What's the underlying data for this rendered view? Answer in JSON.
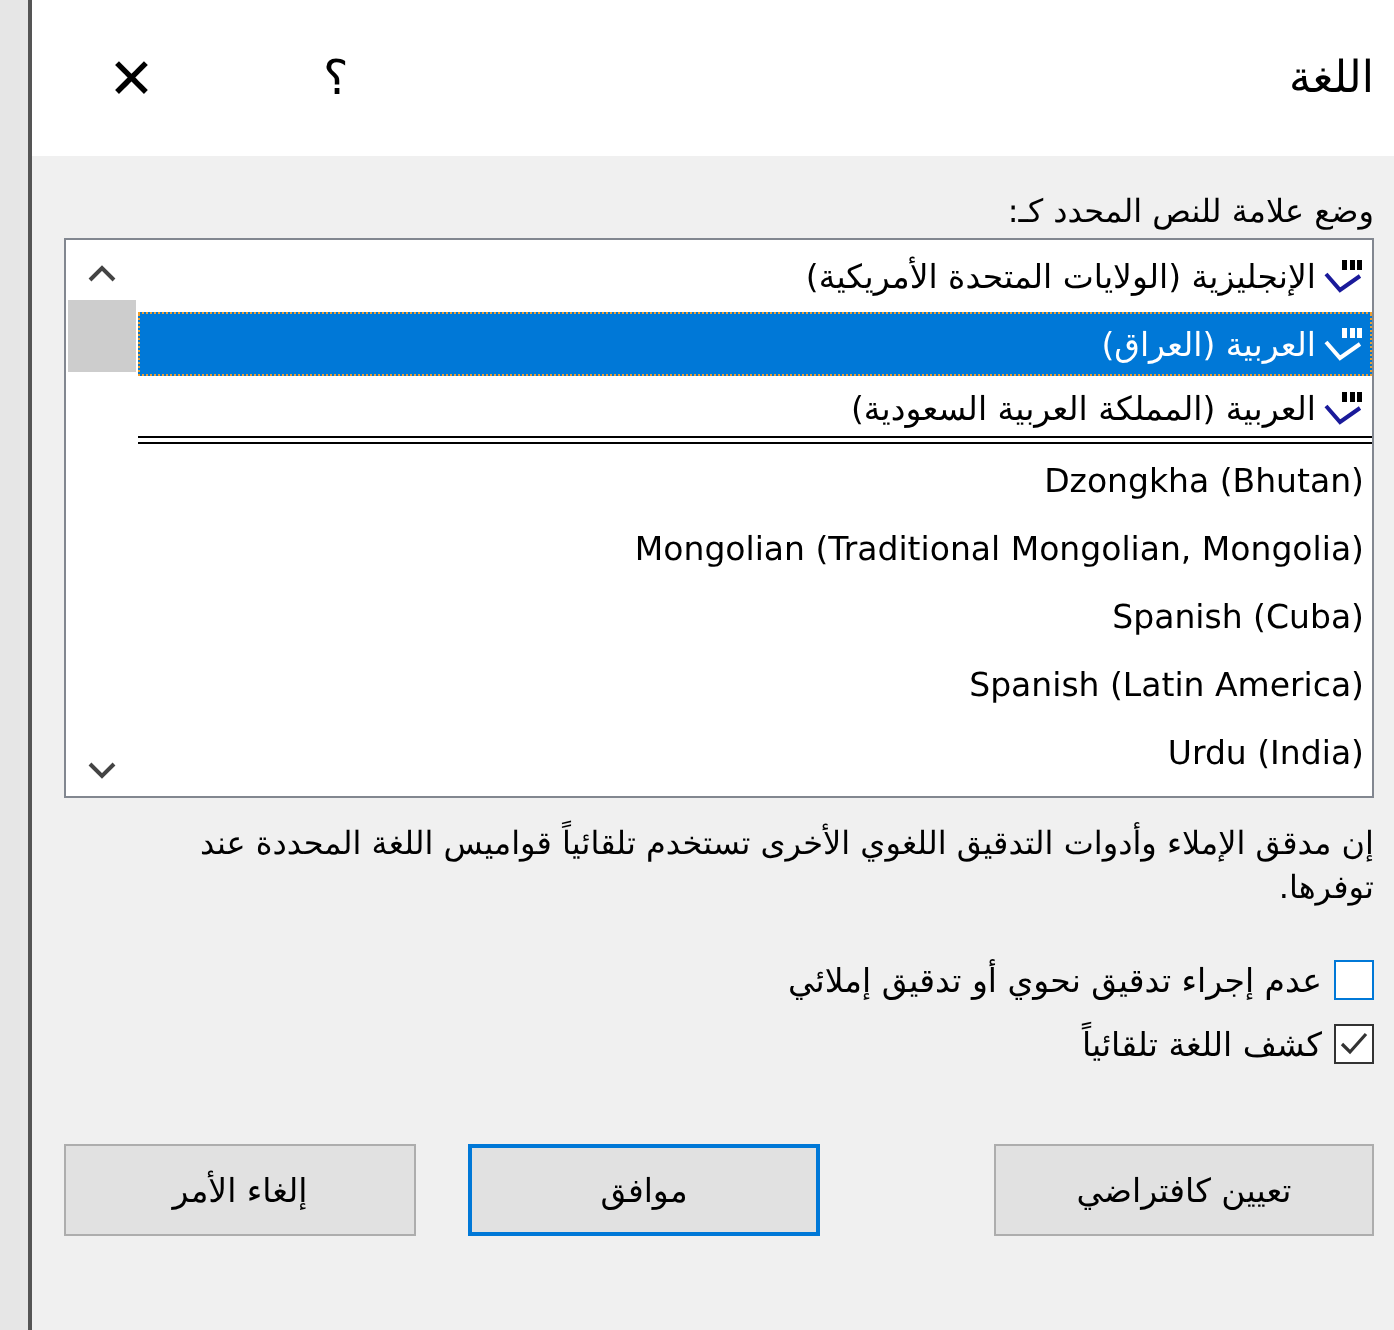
{
  "window": {
    "title": "اللغة",
    "help": "؟",
    "close": "✕"
  },
  "list_label": "وضع علامة للنص المحدد كـ:",
  "languages": [
    {
      "name": "الإنجليزية (الولايات المتحدة الأمريكية)",
      "proofing": true,
      "selected": false
    },
    {
      "name": "العربية (العراق)",
      "proofing": true,
      "selected": true
    },
    {
      "name": "العربية (المملكة العربية السعودية)",
      "proofing": true,
      "selected": false
    },
    {
      "name": "Dzongkha (Bhutan)",
      "proofing": false,
      "selected": false
    },
    {
      "name": "Mongolian (Traditional Mongolian, Mongolia)",
      "proofing": false,
      "selected": false
    },
    {
      "name": "Spanish (Cuba)",
      "proofing": false,
      "selected": false
    },
    {
      "name": "Spanish (Latin America)",
      "proofing": false,
      "selected": false
    },
    {
      "name": "Urdu (India)",
      "proofing": false,
      "selected": false
    }
  ],
  "note": "إن مدقق الإملاء وأدوات التدقيق اللغوي الأخرى تستخدم تلقائياً قواميس اللغة المحددة عند توفرها.",
  "options": [
    {
      "label": "عدم إجراء تدقيق نحوي أو تدقيق إملائي",
      "checked": false
    },
    {
      "label": "كشف اللغة تلقائياً",
      "checked": true
    }
  ],
  "buttons": [
    {
      "label": "تعيين كافتراضي",
      "kind": "normal"
    },
    {
      "label": "موافق",
      "kind": "default"
    },
    {
      "label": "إلغاء الأمر",
      "kind": "normal"
    }
  ]
}
